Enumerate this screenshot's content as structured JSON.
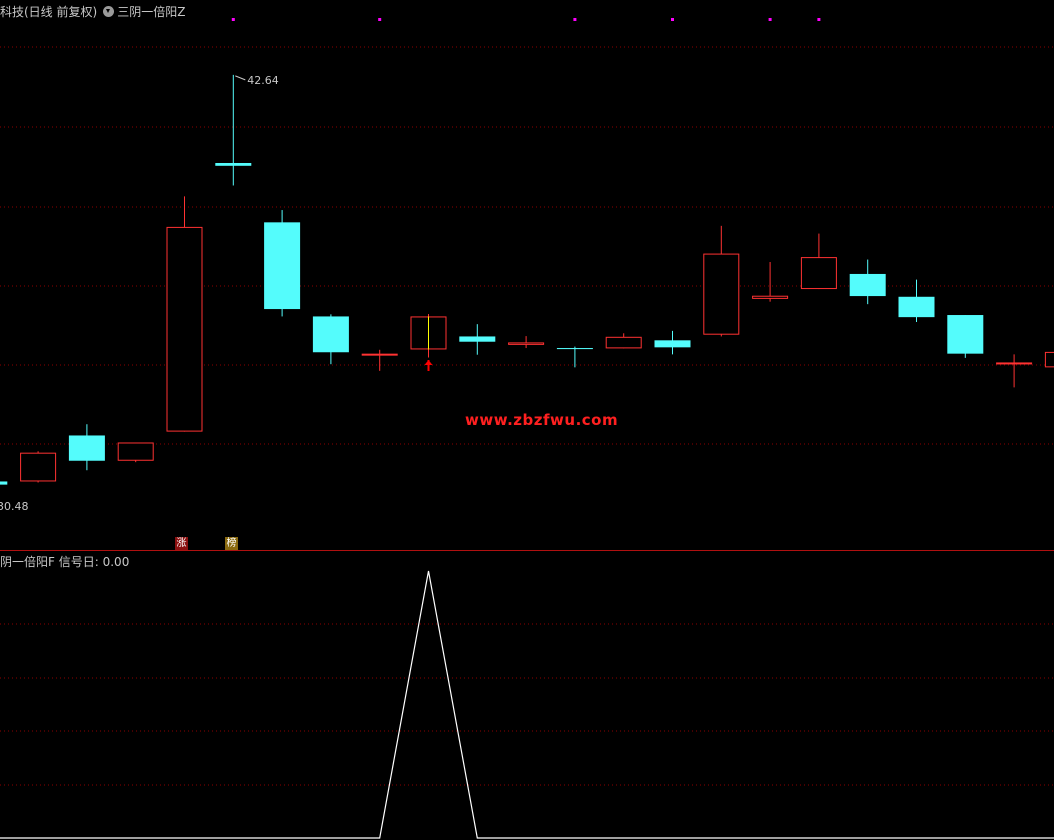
{
  "header": {
    "title": "科技(日线 前复权)",
    "indicator": "三阴一倍阳Z"
  },
  "sub_panel": {
    "title": "阴一倍阳F",
    "signal_label": "信号日:",
    "signal_value": "0.00"
  },
  "watermark": "www.zbzfwu.com",
  "badges": {
    "zhang": "涨",
    "bang": "榜"
  },
  "colors": {
    "up": "#ff3232",
    "down": "#54fcfc",
    "grid": "#8b0000",
    "marker": "#ff00ff",
    "signal_line": "#ffffff",
    "arrow": "#ff0000",
    "doji_mid": "#ffff00"
  },
  "chart_data": [
    {
      "type": "candlestick",
      "title": "",
      "price_range": [
        29.82,
        44.63
      ],
      "grid": true,
      "labels": {
        "high": "42.64",
        "low": "30.48"
      },
      "candles": [
        {
          "o": 31.06,
          "h": 31.06,
          "c": 30.97,
          "l": 30.97
        },
        {
          "o": 31.06,
          "h": 31.92,
          "c": 31.88,
          "l": 31.03
        },
        {
          "o": 32.37,
          "h": 32.69,
          "c": 31.65,
          "l": 31.38
        },
        {
          "o": 31.65,
          "h": 32.14,
          "c": 32.17,
          "l": 31.61
        },
        {
          "o": 32.48,
          "h": 39.18,
          "c": 38.31,
          "l": 32.48
        },
        {
          "o": 40.13,
          "h": 42.64,
          "c": 40.05,
          "l": 39.49
        },
        {
          "o": 38.44,
          "h": 38.79,
          "c": 35.97,
          "l": 35.76
        },
        {
          "o": 35.76,
          "h": 35.82,
          "c": 34.74,
          "l": 34.4
        },
        {
          "o": 34.7,
          "h": 34.81,
          "c": 34.7,
          "l": 34.21
        },
        {
          "o": 34.82,
          "h": 35.83,
          "c": 35.76,
          "l": 34.59
        },
        {
          "o": 35.19,
          "h": 35.54,
          "c": 35.04,
          "l": 34.67
        },
        {
          "o": 34.95,
          "h": 35.2,
          "c": 35.02,
          "l": 34.86
        },
        {
          "o": 34.86,
          "h": 34.9,
          "c": 34.83,
          "l": 34.31
        },
        {
          "o": 34.85,
          "h": 35.28,
          "c": 35.18,
          "l": 34.85
        },
        {
          "o": 35.08,
          "h": 35.35,
          "c": 34.88,
          "l": 34.68
        },
        {
          "o": 35.24,
          "h": 38.34,
          "c": 37.55,
          "l": 35.19
        },
        {
          "o": 36.26,
          "h": 37.31,
          "c": 36.35,
          "l": 36.18
        },
        {
          "o": 36.54,
          "h": 38.12,
          "c": 37.45,
          "l": 36.54
        },
        {
          "o": 36.97,
          "h": 37.38,
          "c": 36.34,
          "l": 36.11
        },
        {
          "o": 36.32,
          "h": 36.81,
          "c": 35.74,
          "l": 35.6
        },
        {
          "o": 35.8,
          "h": 35.8,
          "c": 34.7,
          "l": 34.58
        },
        {
          "o": 34.41,
          "h": 34.68,
          "c": 34.45,
          "l": 33.74
        },
        {
          "o": 34.31,
          "h": 34.75,
          "c": 34.75,
          "l": 34.31
        }
      ],
      "signal_arrow_index": 9,
      "markers_at_indices": [
        5,
        8,
        12,
        14,
        16,
        17
      ]
    },
    {
      "type": "line",
      "title": "",
      "ylim": [
        0,
        1
      ],
      "series": [
        {
          "values": [
            0,
            0,
            0,
            0,
            0,
            0,
            0,
            0,
            0,
            1,
            0,
            0,
            0,
            0,
            0,
            0,
            0,
            0,
            0,
            0,
            0,
            0,
            0
          ]
        }
      ]
    }
  ]
}
